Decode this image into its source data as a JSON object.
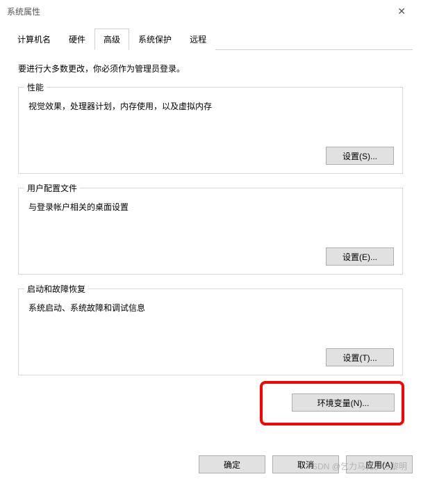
{
  "window": {
    "title": "系统属性",
    "close": "✕"
  },
  "tabs": {
    "items": [
      {
        "label": "计算机名"
      },
      {
        "label": "硬件"
      },
      {
        "label": "高级"
      },
      {
        "label": "系统保护"
      },
      {
        "label": "远程"
      }
    ],
    "activeIndex": 2
  },
  "advanced": {
    "intro": "要进行大多数更改，你必须作为管理员登录。",
    "performance": {
      "title": "性能",
      "desc": "视觉效果，处理器计划，内存使用，以及虚拟内存",
      "button": "设置(S)..."
    },
    "userProfiles": {
      "title": "用户配置文件",
      "desc": "与登录帐户相关的桌面设置",
      "button": "设置(E)..."
    },
    "startupRecovery": {
      "title": "启动和故障恢复",
      "desc": "系统启动、系统故障和调试信息",
      "button": "设置(T)..."
    },
    "envVarButton": "环境变量(N)..."
  },
  "dialogButtons": {
    "ok": "确定",
    "cancel": "取消",
    "apply": "应用(A)"
  },
  "watermark": "SDN @乞力马扎罗の黎明"
}
